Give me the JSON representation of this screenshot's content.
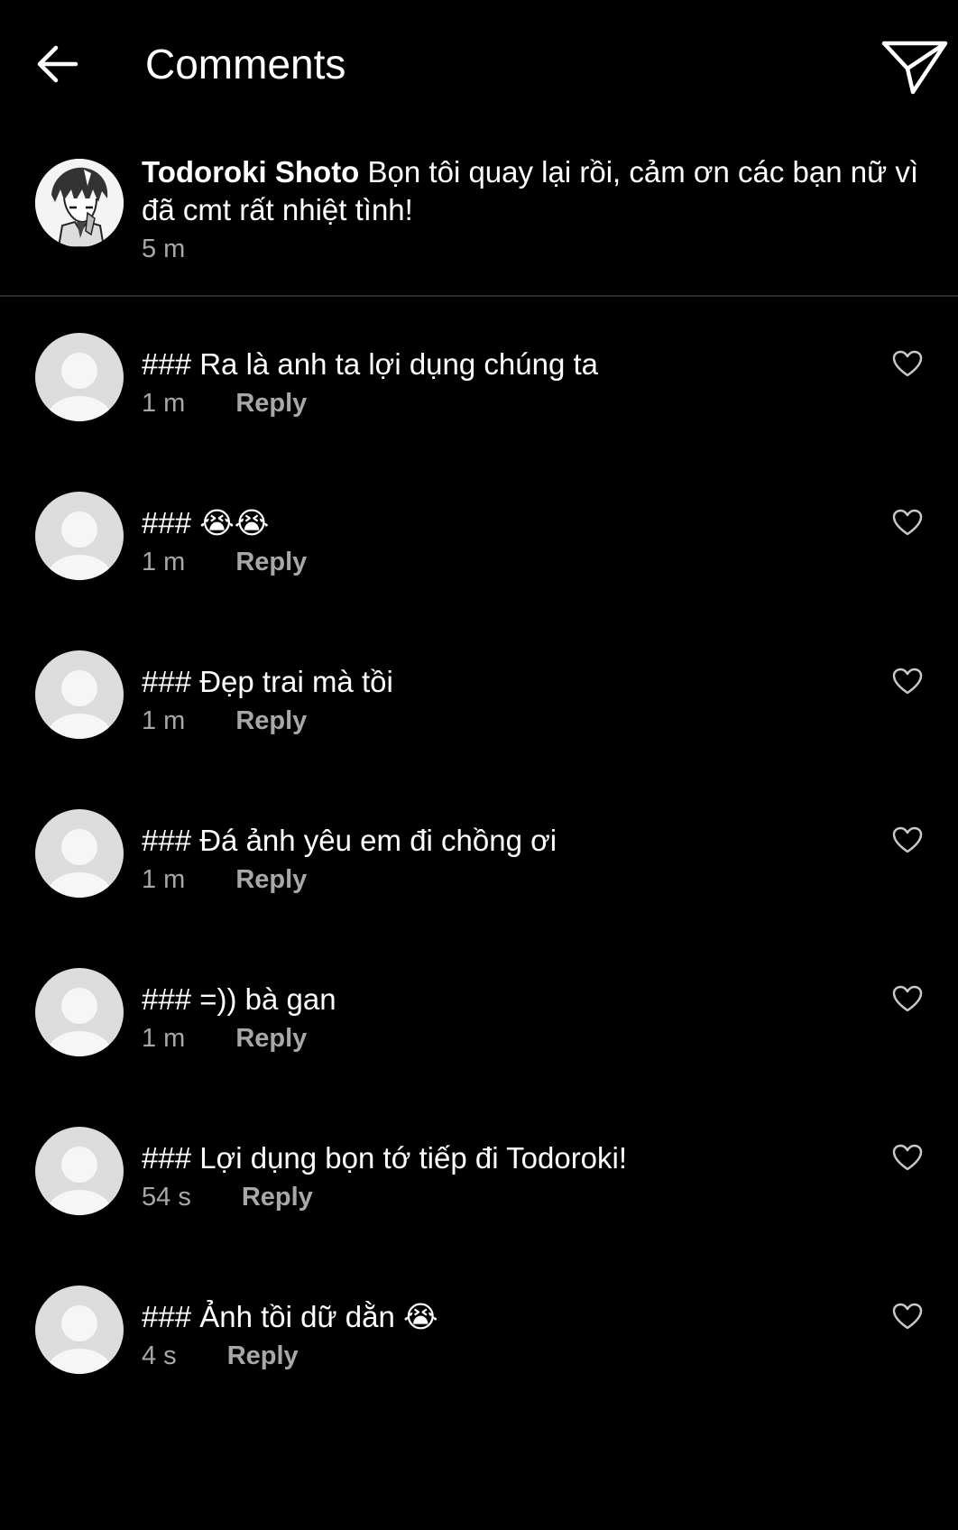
{
  "header": {
    "title": "Comments",
    "back_icon": "arrow-left-icon",
    "send_icon": "paper-plane-icon"
  },
  "caption": {
    "username": "Todoroki Shoto",
    "text": "Bọn tôi quay lại rồi, cảm ơn các bạn nữ vì đã cmt rất nhiệt tình!",
    "time": "5 m"
  },
  "comments": [
    {
      "text": "### Ra là anh ta lợi dụng chúng ta",
      "time": "1 m",
      "reply_label": "Reply"
    },
    {
      "text": "### 😭😭",
      "time": "1 m",
      "reply_label": "Reply"
    },
    {
      "text": "### Đẹp trai mà tồi",
      "time": "1 m",
      "reply_label": "Reply"
    },
    {
      "text": "### Đá ảnh yêu em đi chồng ơi",
      "time": "1 m",
      "reply_label": "Reply"
    },
    {
      "text": "### =)) bà gan",
      "time": "1 m",
      "reply_label": "Reply"
    },
    {
      "text": "### Lợi dụng bọn tớ tiếp đi Todoroki!",
      "time": "54 s",
      "reply_label": "Reply"
    },
    {
      "text": "### Ảnh tồi dữ dằn 😭",
      "time": "4 s",
      "reply_label": "Reply"
    }
  ],
  "colors": {
    "background": "#000000",
    "text": "#ffffff",
    "secondary_text": "#a8a8a8",
    "placeholder_avatar": "#dcdcdc"
  }
}
